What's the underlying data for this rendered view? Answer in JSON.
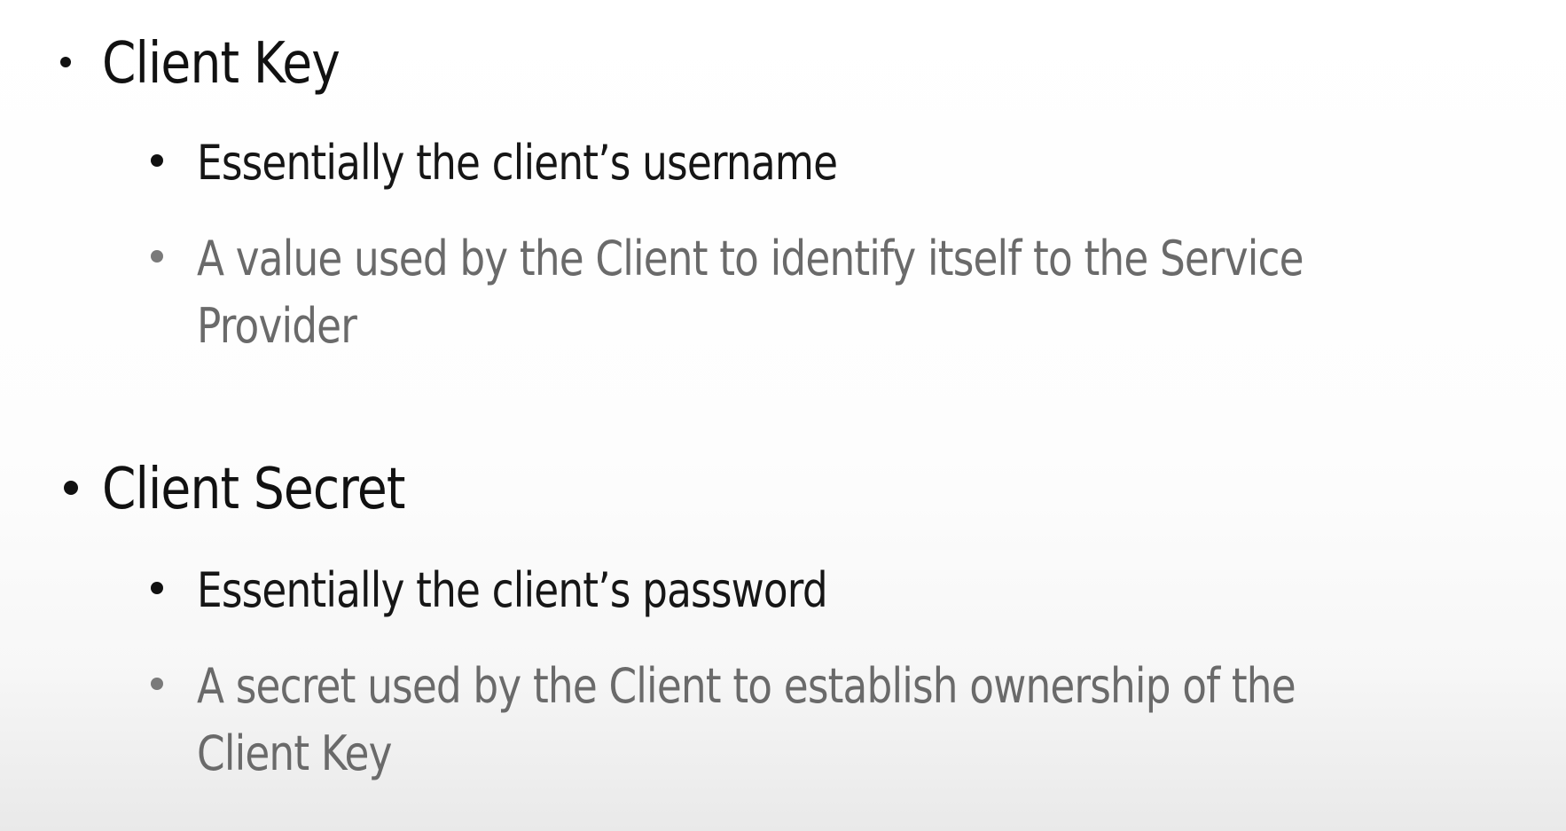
{
  "slide": {
    "sections": [
      {
        "heading": "Client Key",
        "points": [
          "Essentially the client’s username",
          "A value used by the Client to identify itself to the Service Provider"
        ]
      },
      {
        "heading": "Client Secret",
        "points": [
          "Essentially the client’s password",
          "A secret used by the Client to establish ownership of the Client Key"
        ]
      }
    ]
  },
  "colors": {
    "heading_text": "#111111",
    "primary_point_text": "#161616",
    "secondary_point_text": "#6a6a6a",
    "secondary_bullet": "#7a7a7a"
  }
}
